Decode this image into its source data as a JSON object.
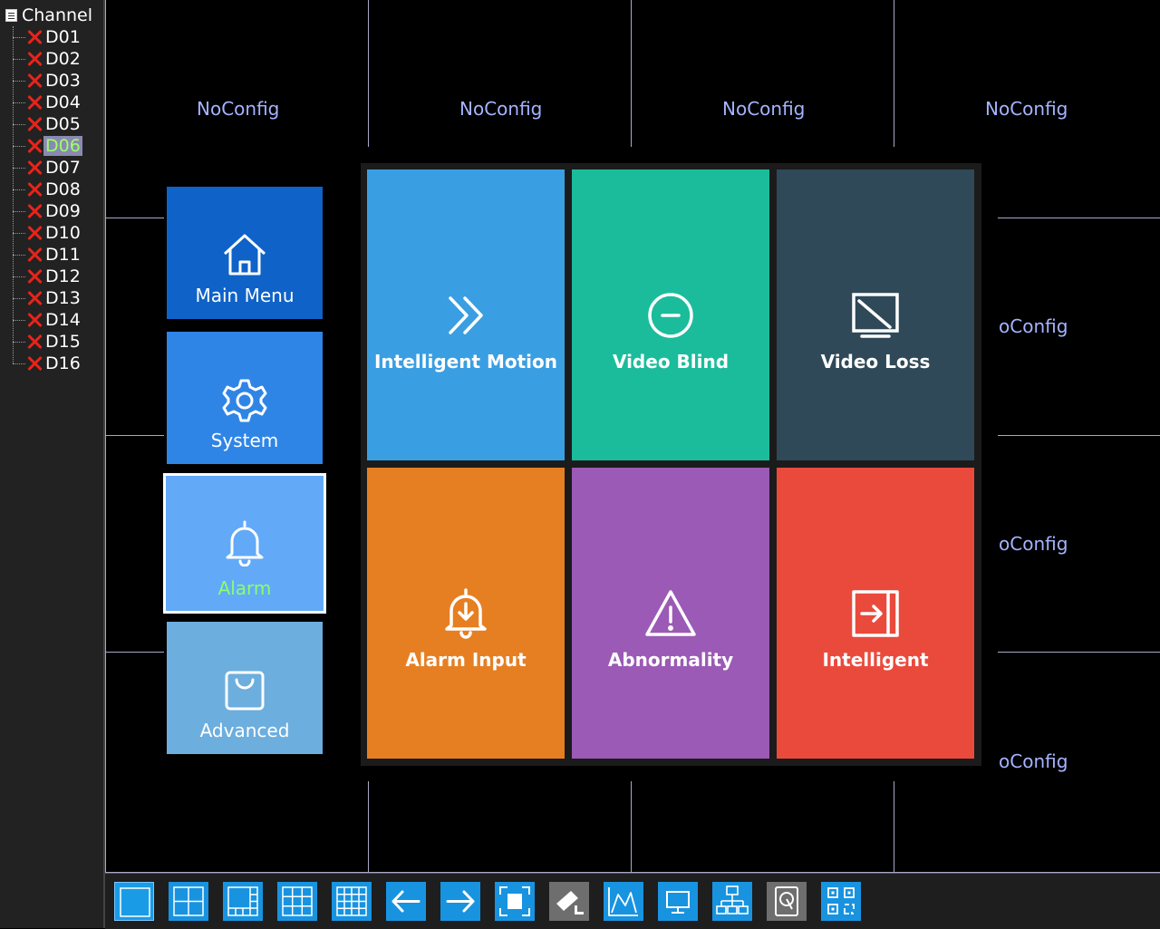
{
  "channel_tree": {
    "root_label": "Channel",
    "selected": "D06",
    "channels": [
      "D01",
      "D02",
      "D03",
      "D04",
      "D05",
      "D06",
      "D07",
      "D08",
      "D09",
      "D10",
      "D11",
      "D12",
      "D13",
      "D14",
      "D15",
      "D16"
    ],
    "status_icon": "red-x-icon"
  },
  "grid": {
    "top_labels": [
      "NoConfig",
      "NoConfig",
      "NoConfig",
      "NoConfig"
    ],
    "right_labels": [
      "oConfig",
      "oConfig",
      "oConfig"
    ]
  },
  "nav": {
    "main_menu": "Main Menu",
    "system": "System",
    "alarm": "Alarm",
    "advanced": "Advanced"
  },
  "alarm_functions": {
    "intelligent_motion": "Intelligent Motion",
    "video_blind": "Video Blind",
    "video_loss": "Video Loss",
    "alarm_input": "Alarm Input",
    "abnormality": "Abnormality",
    "intelligent": "Intelligent"
  },
  "toolbar": {
    "buttons": [
      "single-view-icon",
      "quad-view-icon",
      "eight-view-icon",
      "nine-view-icon",
      "sixteen-view-icon",
      "previous-icon",
      "next-icon",
      "fullscreen-icon",
      "ptz-camera-icon",
      "statistics-icon",
      "monitor-icon",
      "network-icon",
      "hdd-icon",
      "qr-code-icon"
    ]
  },
  "colors": {
    "main_menu": "#0f62c8",
    "system": "#2f85e6",
    "alarm": "#62a9f8",
    "advanced": "#6caede",
    "intelligent_motion": "#3a9ee2",
    "video_blind": "#1bbc9b",
    "video_loss": "#2f4958",
    "alarm_input": "#e67f22",
    "abnormality": "#9b5ab5",
    "intelligent": "#ea4a3c",
    "selected_text": "#8aff6c",
    "noconfig_text": "#a4b4ff"
  }
}
